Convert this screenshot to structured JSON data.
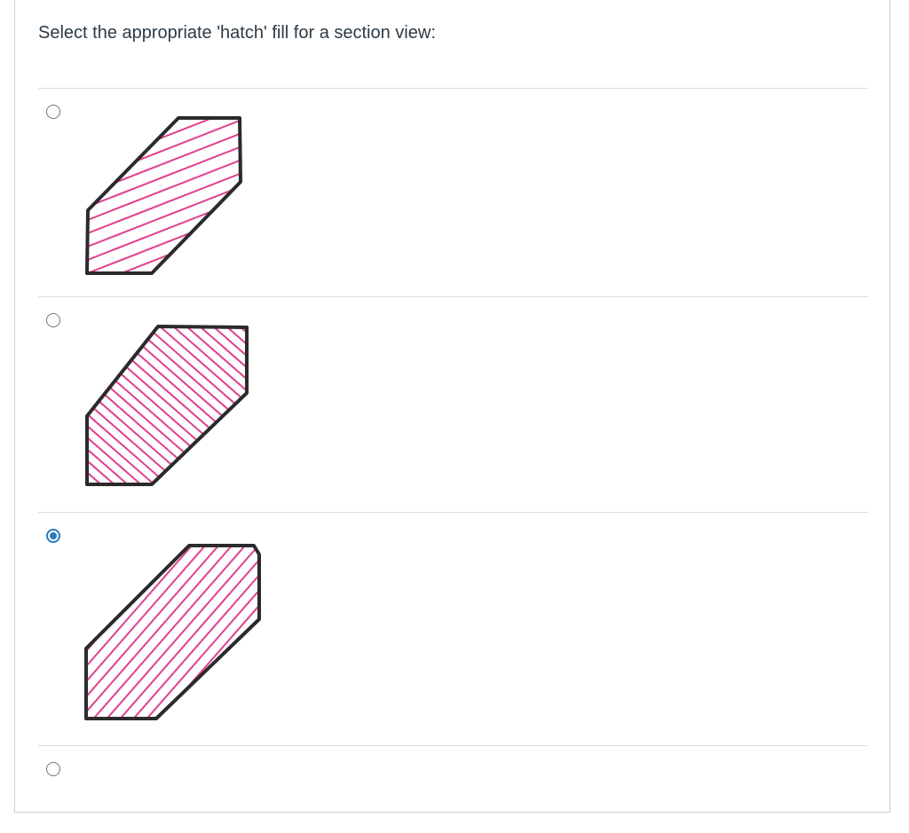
{
  "question": {
    "text": "Select the appropriate 'hatch' fill for a section view:"
  },
  "answers": [
    {
      "id": "option-1",
      "hatch": "diagonal-shallow",
      "selected": false
    },
    {
      "id": "option-2",
      "hatch": "diagonal-descending",
      "selected": false
    },
    {
      "id": "option-3",
      "hatch": "diagonal-ascending",
      "selected": true
    },
    {
      "id": "option-4",
      "hatch": "none",
      "selected": false
    }
  ],
  "colors": {
    "hatch": "#e0418f",
    "outline": "#2b2b2b",
    "selected_radio": "#2b7abc",
    "divider": "#d8dcdf"
  }
}
